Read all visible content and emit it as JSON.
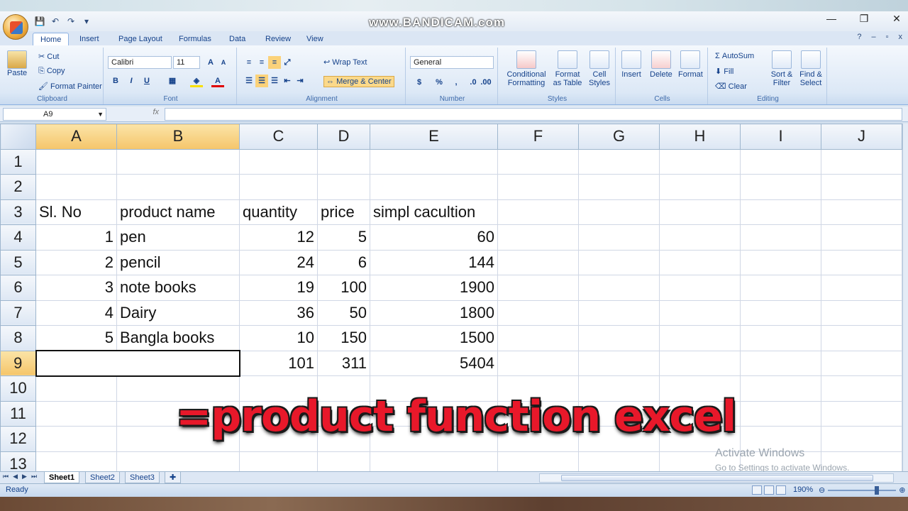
{
  "watermark": "www.BANDICAM.com",
  "window": {
    "min": "—",
    "restore": "❐",
    "close": "✕"
  },
  "qat": {
    "save": "💾",
    "undo": "↶",
    "redo": "↷",
    "more": "▾"
  },
  "tabs": [
    "Home",
    "Insert",
    "Page Layout",
    "Formulas",
    "Data",
    "Review",
    "View"
  ],
  "ribbon": {
    "clipboard": {
      "paste": "Paste",
      "cut": "Cut",
      "copy": "Copy",
      "format_painter": "Format Painter",
      "name": "Clipboard"
    },
    "font": {
      "family": "Calibri",
      "size": "11",
      "bold": "B",
      "italic": "I",
      "underline": "U",
      "name": "Font"
    },
    "alignment": {
      "wrap": "Wrap Text",
      "merge": "Merge & Center",
      "name": "Alignment"
    },
    "number": {
      "format": "General",
      "currency": "$",
      "percent": "%",
      "comma": ",",
      "name": "Number"
    },
    "styles": {
      "conditional": "Conditional Formatting",
      "format_table": "Format as Table",
      "cell_styles": "Cell Styles",
      "name": "Styles"
    },
    "cells": {
      "insert": "Insert",
      "delete": "Delete",
      "format": "Format",
      "name": "Cells"
    },
    "editing": {
      "autosum": "AutoSum",
      "fill": "Fill",
      "clear": "Clear",
      "sort": "Sort & Filter",
      "find": "Find & Select",
      "name": "Editing"
    }
  },
  "formula_bar": {
    "name_box": "A9",
    "fx": "fx",
    "value": ""
  },
  "columns": [
    "A",
    "B",
    "C",
    "D",
    "E",
    "F",
    "G",
    "H",
    "I",
    "J"
  ],
  "rows": [
    {
      "n": "1",
      "cells": [
        "",
        "",
        "",
        "",
        ""
      ]
    },
    {
      "n": "2",
      "cells": [
        "",
        "",
        "",
        "",
        ""
      ]
    },
    {
      "n": "3",
      "cells": [
        "Sl. No",
        "product name",
        "quantity",
        "price",
        "simpl cacultion"
      ]
    },
    {
      "n": "4",
      "cells": [
        "1",
        "pen",
        "12",
        "5",
        "60"
      ]
    },
    {
      "n": "5",
      "cells": [
        "2",
        "pencil",
        "24",
        "6",
        "144"
      ]
    },
    {
      "n": "6",
      "cells": [
        "3",
        "note books",
        "19",
        "100",
        "1900"
      ]
    },
    {
      "n": "7",
      "cells": [
        "4",
        "Dairy",
        "36",
        "50",
        "1800"
      ]
    },
    {
      "n": "8",
      "cells": [
        "5",
        "Bangla books",
        "10",
        "150",
        "1500"
      ]
    },
    {
      "n": "9",
      "cells": [
        "",
        "",
        "101",
        "311",
        "5404"
      ]
    },
    {
      "n": "10",
      "cells": [
        "",
        "",
        "",
        "",
        ""
      ]
    },
    {
      "n": "11",
      "cells": [
        "",
        "",
        "",
        "",
        ""
      ]
    },
    {
      "n": "12",
      "cells": [
        "",
        "",
        "",
        "",
        ""
      ]
    },
    {
      "n": "13",
      "cells": [
        "",
        "",
        "",
        "",
        ""
      ]
    }
  ],
  "caption": "=product function excel",
  "activate": {
    "title": "Activate Windows",
    "sub": "Go to Settings to activate Windows."
  },
  "sheets": [
    "Sheet1",
    "Sheet2",
    "Sheet3"
  ],
  "status": {
    "ready": "Ready",
    "zoom": "190%"
  }
}
